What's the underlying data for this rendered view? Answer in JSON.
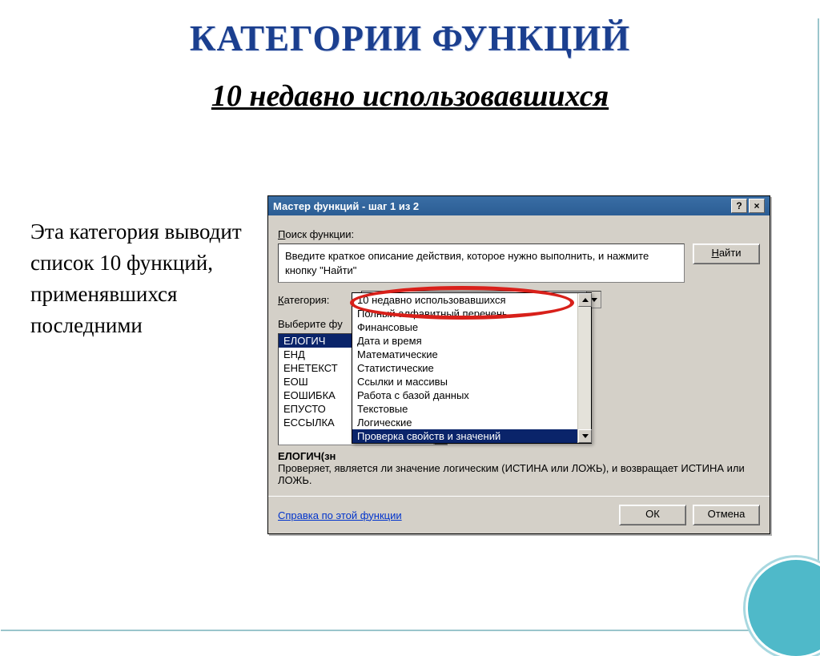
{
  "slide": {
    "title": "КАТЕГОРИИ ФУНКЦИЙ",
    "subtitle": "10 недавно использовавшихся",
    "body": "Эта категория выводит список 10 функций, применявшихся последними"
  },
  "dialog": {
    "title": "Мастер функций - шаг 1 из 2",
    "help_btn": "?",
    "close_btn": "×",
    "search_label_pre": "П",
    "search_label_rest": "оиск функции:",
    "search_text": "Введите краткое описание действия, которое нужно выполнить, и нажмите кнопку \"Найти\"",
    "find_btn_pre": "Н",
    "find_btn_rest": "айти",
    "category_label_pre": "К",
    "category_label_rest": "атегория:",
    "category_value": "10 недавно использовавшихся",
    "select_label": "Выберите фу",
    "category_options": [
      "10 недавно использовавшихся",
      "Полный алфавитный перечень",
      "Финансовые",
      "Дата и время",
      "Математические",
      "Статистические",
      "Ссылки и массивы",
      "Работа с базой данных",
      "Текстовые",
      "Логические",
      "Проверка свойств и значений"
    ],
    "dropdown_selected_index": 10,
    "function_list": [
      "ЕЛОГИЧ",
      "ЕНД",
      "ЕНЕТЕКСТ",
      "ЕОШ",
      "ЕОШИБКА",
      "ЕПУСТО",
      "ЕССЫЛКА"
    ],
    "function_selected_index": 0,
    "func_signature": "ЕЛОГИЧ(зн",
    "func_description": "Проверяет, является ли значение логическим (ИСТИНА или ЛОЖЬ), и возвращает ИСТИНА или ЛОЖЬ.",
    "help_link": "Справка по этой функции",
    "ok_btn": "ОК",
    "cancel_btn": "Отмена"
  }
}
